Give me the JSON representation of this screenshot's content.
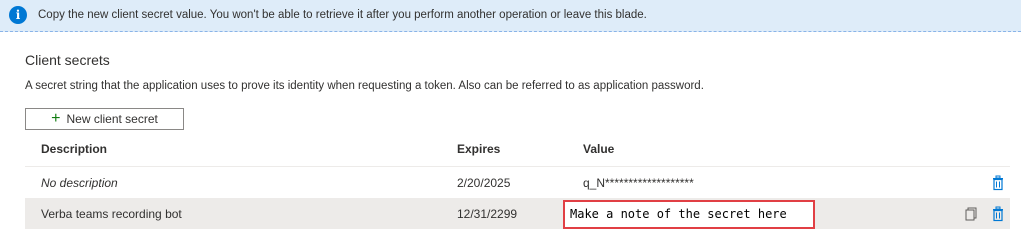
{
  "banner": {
    "message": "Copy the new client secret value. You won't be able to retrieve it after you perform another operation or leave this blade."
  },
  "section": {
    "title": "Client secrets",
    "description": "A secret string that the application uses to prove its identity when requesting a token. Also can be referred to as application password."
  },
  "new_button_label": "New client secret",
  "table": {
    "headers": {
      "description": "Description",
      "expires": "Expires",
      "value": "Value"
    },
    "rows": [
      {
        "description": "No description",
        "expires": "2/20/2025",
        "value": "q_N*******************"
      },
      {
        "description": "Verba teams recording bot",
        "expires": "12/31/2299",
        "value": "Make a note of the secret here"
      }
    ]
  },
  "colors": {
    "accent": "#0078d4",
    "banner_bg": "#deecf9",
    "highlight_border": "#e13f44"
  },
  "icons": [
    "info-icon",
    "plus-icon",
    "copy-icon",
    "trash-icon"
  ]
}
